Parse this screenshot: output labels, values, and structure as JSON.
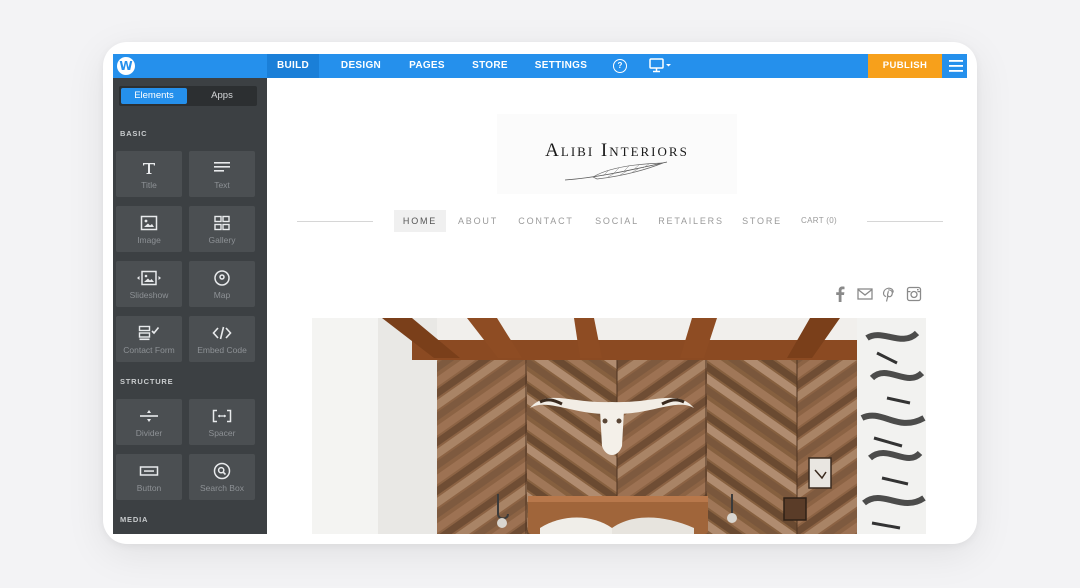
{
  "editor": {
    "logo_letter": "W",
    "tabs": [
      {
        "label": "BUILD",
        "active": true
      },
      {
        "label": "DESIGN",
        "active": false
      },
      {
        "label": "PAGES",
        "active": false
      },
      {
        "label": "STORE",
        "active": false
      },
      {
        "label": "SETTINGS",
        "active": false
      }
    ],
    "help_label": "?",
    "publish_label": "PUBLISH",
    "colors": {
      "accent": "#2590ec",
      "publish": "#f7a01b",
      "sidebar": "#3c4043"
    }
  },
  "sidebar": {
    "toggle": {
      "elements": "Elements",
      "apps": "Apps"
    },
    "sections": {
      "basic": "BASIC",
      "structure": "STRUCTURE",
      "media": "MEDIA"
    },
    "basic_items": [
      {
        "label": "Title",
        "icon": "title-icon"
      },
      {
        "label": "Text",
        "icon": "text-icon"
      },
      {
        "label": "Image",
        "icon": "image-icon"
      },
      {
        "label": "Gallery",
        "icon": "gallery-icon"
      },
      {
        "label": "Slideshow",
        "icon": "slideshow-icon"
      },
      {
        "label": "Map",
        "icon": "map-icon"
      },
      {
        "label": "Contact Form",
        "icon": "contact-form-icon"
      },
      {
        "label": "Embed Code",
        "icon": "embed-code-icon"
      }
    ],
    "structure_items": [
      {
        "label": "Divider",
        "icon": "divider-icon"
      },
      {
        "label": "Spacer",
        "icon": "spacer-icon"
      },
      {
        "label": "Button",
        "icon": "button-icon"
      },
      {
        "label": "Search Box",
        "icon": "search-box-icon"
      }
    ],
    "star": "★"
  },
  "site": {
    "brand": "Alibi Interiors",
    "nav": [
      {
        "label": "HOME",
        "active": true
      },
      {
        "label": "ABOUT",
        "active": false
      },
      {
        "label": "CONTACT",
        "active": false
      },
      {
        "label": "SOCIAL",
        "active": false
      },
      {
        "label": "RETAILERS",
        "active": false
      },
      {
        "label": "STORE",
        "active": false
      },
      {
        "label": "CART (0)",
        "active": false
      }
    ],
    "social_icons": [
      "facebook-icon",
      "mail-icon",
      "pinterest-icon",
      "instagram-icon"
    ]
  }
}
